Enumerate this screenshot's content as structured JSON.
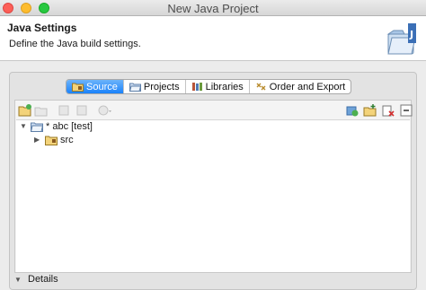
{
  "window": {
    "title": "New Java Project"
  },
  "banner": {
    "title": "Java Settings",
    "description": "Define the Java build settings."
  },
  "tabs": [
    {
      "label": "Source",
      "active": true,
      "icon": "source-folder-icon"
    },
    {
      "label": "Projects",
      "active": false,
      "icon": "projects-icon"
    },
    {
      "label": "Libraries",
      "active": false,
      "icon": "libraries-icon"
    },
    {
      "label": "Order and Export",
      "active": false,
      "icon": "order-export-icon"
    }
  ],
  "tree": {
    "root": {
      "label": "* abc [test]",
      "expanded": true
    },
    "children": [
      {
        "label": "src",
        "expanded": false
      }
    ]
  },
  "details": {
    "label": "Details",
    "expanded": false
  },
  "colors": {
    "tab_active": "#1a82fb",
    "folder": "#e8b84a"
  }
}
